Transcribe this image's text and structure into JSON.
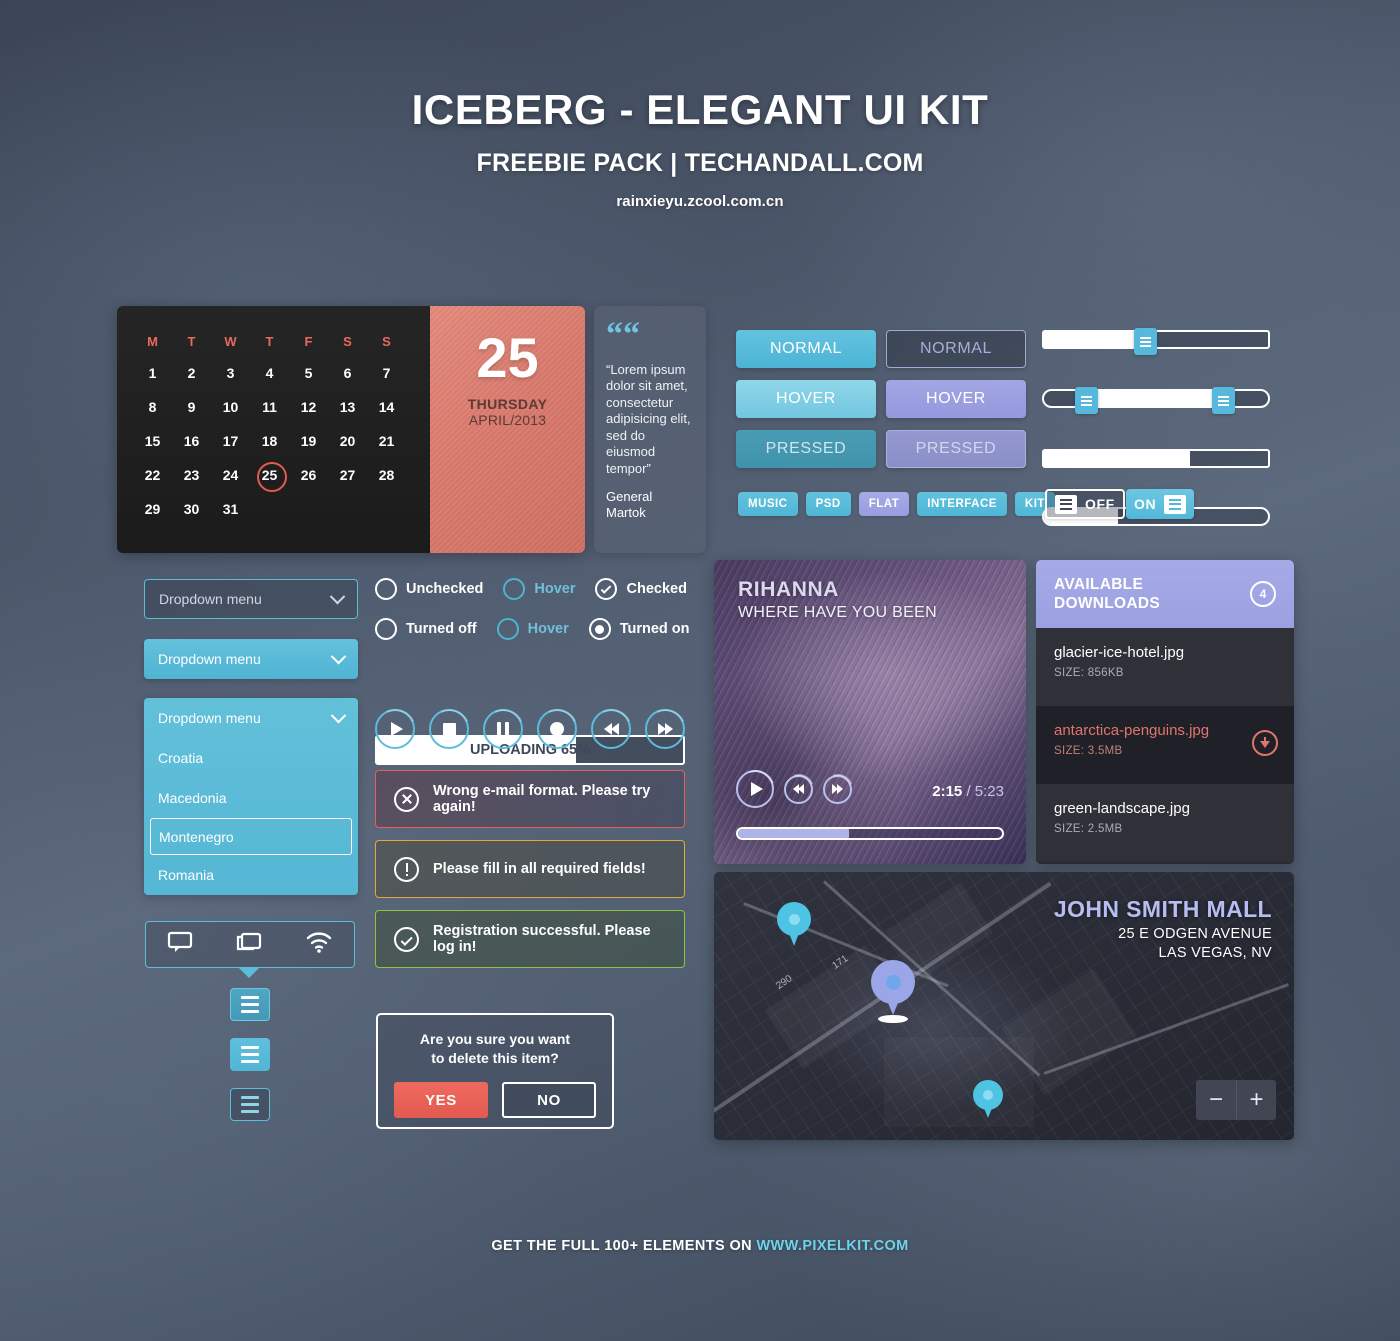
{
  "header": {
    "title": "ICEBERG - ELEGANT UI KIT",
    "subtitle": "FREEBIE PACK | TECHANDALL.COM",
    "url": "rainxieyu.zcool.com.cn"
  },
  "calendar": {
    "dow": [
      "M",
      "T",
      "W",
      "T",
      "F",
      "S",
      "S"
    ],
    "weeks": [
      [
        "1",
        "2",
        "3",
        "4",
        "5",
        "6",
        "7"
      ],
      [
        "8",
        "9",
        "10",
        "11",
        "12",
        "13",
        "14"
      ],
      [
        "15",
        "16",
        "17",
        "18",
        "19",
        "20",
        "21"
      ],
      [
        "22",
        "23",
        "24",
        "25",
        "26",
        "27",
        "28"
      ],
      [
        "29",
        "30",
        "31",
        "",
        "",
        "",
        ""
      ]
    ],
    "today": "25",
    "big_day": "25",
    "weekday": "THURSDAY",
    "monthyear": "APRIL/2013"
  },
  "quote": {
    "mark": "““",
    "text": "“Lorem ipsum dolor sit amet, consectetur adipisicing elit, sed do eiusmod tempor”",
    "author": "General Martok"
  },
  "buttons": {
    "blue": {
      "normal": "NORMAL",
      "hover": "HOVER",
      "pressed": "PRESSED"
    },
    "purple": {
      "normal": "NORMAL",
      "hover": "HOVER",
      "pressed": "PRESSED"
    }
  },
  "tags": [
    {
      "label": "MUSIC",
      "color": "blue"
    },
    {
      "label": "PSD",
      "color": "blue"
    },
    {
      "label": "FLAT",
      "color": "purple"
    },
    {
      "label": "INTERFACE",
      "color": "blue"
    },
    {
      "label": "KIT",
      "color": "blue"
    }
  ],
  "sliders": [
    {
      "name": "single-handle-slider",
      "value_pct": 44,
      "type": "single"
    },
    {
      "name": "range-slider",
      "start_pct": 18,
      "end_pct": 78,
      "type": "range"
    },
    {
      "name": "progress-slider-square",
      "value_pct": 65,
      "type": "fill-square"
    },
    {
      "name": "progress-slider-round",
      "value_pct": 33,
      "type": "fill-round"
    }
  ],
  "toggles": {
    "off_label": "OFF",
    "on_label": "ON"
  },
  "dropdowns": {
    "outline_label": "Dropdown menu",
    "solid_label": "Dropdown menu",
    "open_label": "Dropdown menu",
    "options": [
      "Croatia",
      "Macedonia",
      "Montenegro",
      "Romania"
    ],
    "selected": "Montenegro"
  },
  "checkboxes": [
    {
      "label": "Unchecked",
      "state": "unchecked"
    },
    {
      "label": "Hover",
      "state": "hover"
    },
    {
      "label": "Checked",
      "state": "checked"
    }
  ],
  "radios": [
    {
      "label": "Turned off",
      "state": "off"
    },
    {
      "label": "Hover",
      "state": "hover"
    },
    {
      "label": "Turned on",
      "state": "on"
    }
  ],
  "progress": {
    "label": "UPLOADING 65%",
    "value_pct": 65
  },
  "media_controls": [
    "play-icon",
    "stop-icon",
    "pause-icon",
    "record-icon",
    "rewind-icon",
    "fast-forward-icon"
  ],
  "alerts": [
    {
      "type": "error",
      "icon": "close-circle-icon",
      "text": "Wrong e-mail format. Please try again!"
    },
    {
      "type": "warning",
      "icon": "exclamation-circle-icon",
      "text": "Please fill in all required fields!"
    },
    {
      "type": "success",
      "icon": "check-circle-icon",
      "text": "Registration successful. Please log in!"
    }
  ],
  "devices": [
    "monitor-icon",
    "tablet-icon",
    "wifi-icon"
  ],
  "hamburgers": [
    "hamburger-button-pressed",
    "hamburger-button-normal",
    "hamburger-button-outline"
  ],
  "confirm": {
    "line1": "Are you sure you want",
    "line2": "to delete this item?",
    "yes": "YES",
    "no": "NO"
  },
  "music": {
    "artist": "RIHANNA",
    "track": "WHERE HAVE YOU BEEN",
    "current_time": "2:15",
    "separator": "/",
    "total_time": "5:23",
    "progress_pct": 42,
    "controls": [
      "play-icon",
      "rewind-icon",
      "fast-forward-icon"
    ]
  },
  "downloads": {
    "title_line1": "AVAILABLE",
    "title_line2": "DOWNLOADS",
    "count": "4",
    "items": [
      {
        "name": "glacier-ice-hotel.jpg",
        "size": "SIZE: 856KB",
        "active": false
      },
      {
        "name": "antarctica-penguins.jpg",
        "size": "SIZE: 3.5MB",
        "active": true
      },
      {
        "name": "green-landscape.jpg",
        "size": "SIZE: 2.5MB",
        "active": false
      }
    ]
  },
  "map": {
    "name": "JOHN SMITH MALL",
    "address_line1": "25 E ODGEN AVENUE",
    "address_line2": "LAS VEGAS, NV",
    "zoom_out": "−",
    "zoom_in": "+",
    "road_labels": [
      "290",
      "171"
    ]
  },
  "footer": {
    "text": "GET THE FULL 100+ ELEMENTS ON ",
    "link": "WWW.PIXELKIT.COM"
  }
}
